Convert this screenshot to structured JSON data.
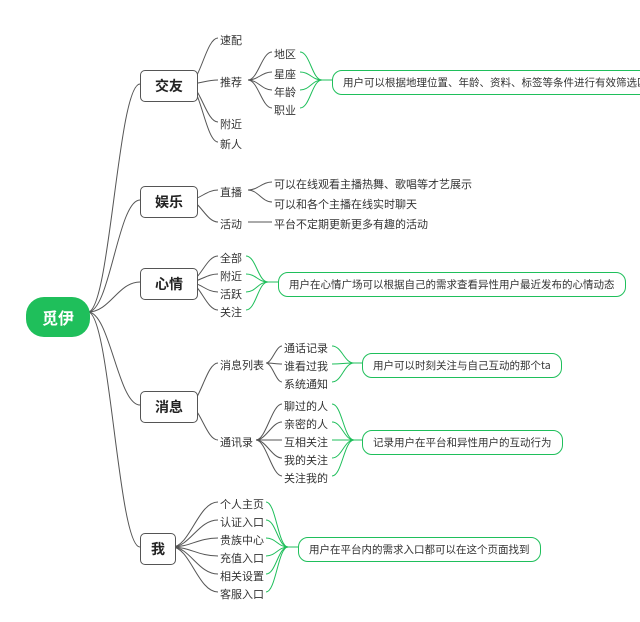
{
  "root": "觅伊",
  "branches": [
    {
      "id": "friends",
      "label": "交友",
      "children": [
        {
          "label": "速配"
        },
        {
          "label": "推荐",
          "children": [
            {
              "label": "地区"
            },
            {
              "label": "星座"
            },
            {
              "label": "年龄"
            },
            {
              "label": "职业"
            }
          ],
          "note": "用户可以根据地理位置、年龄、资料、标签等条件进行有效筛选匹配"
        },
        {
          "label": "附近"
        },
        {
          "label": "新人"
        }
      ]
    },
    {
      "id": "entertain",
      "label": "娱乐",
      "children": [
        {
          "label": "直播",
          "children": [
            {
              "label": "可以在线观看主播热舞、歌唱等才艺展示"
            },
            {
              "label": "可以和各个主播在线实时聊天"
            }
          ]
        },
        {
          "label": "活动",
          "children": [
            {
              "label": "平台不定期更新更多有趣的活动"
            }
          ]
        }
      ]
    },
    {
      "id": "mood",
      "label": "心情",
      "children": [
        {
          "label": "全部"
        },
        {
          "label": "附近"
        },
        {
          "label": "活跃"
        },
        {
          "label": "关注"
        }
      ],
      "note": "用户在心情广场可以根据自己的需求查看异性用户最近发布的心情动态"
    },
    {
      "id": "msg",
      "label": "消息",
      "children": [
        {
          "label": "消息列表",
          "children": [
            {
              "label": "通话记录"
            },
            {
              "label": "谁看过我"
            },
            {
              "label": "系统通知"
            }
          ],
          "note": "用户可以时刻关注与自己互动的那个ta"
        },
        {
          "label": "通讯录",
          "children": [
            {
              "label": "聊过的人"
            },
            {
              "label": "亲密的人"
            },
            {
              "label": "互相关注"
            },
            {
              "label": "我的关注"
            },
            {
              "label": "关注我的"
            }
          ],
          "note": "记录用户在平台和异性用户的互动行为"
        }
      ]
    },
    {
      "id": "me",
      "label": "我",
      "children": [
        {
          "label": "个人主页"
        },
        {
          "label": "认证入口"
        },
        {
          "label": "贵族中心"
        },
        {
          "label": "充值入口"
        },
        {
          "label": "相关设置"
        },
        {
          "label": "客服入口"
        }
      ],
      "note": "用户在平台内的需求入口都可以在这个页面找到"
    }
  ],
  "chart_data": {
    "type": "mindmap",
    "root": "觅伊",
    "branches": [
      "交友",
      "娱乐",
      "心情",
      "消息",
      "我"
    ]
  }
}
